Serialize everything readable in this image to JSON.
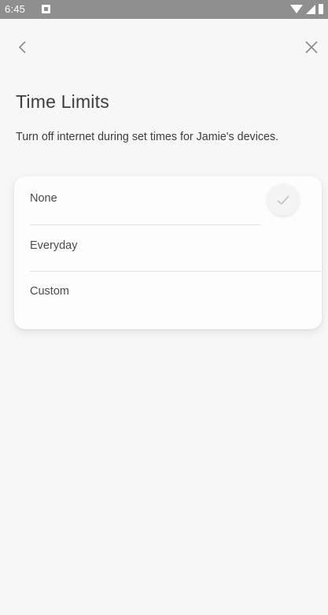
{
  "status_bar": {
    "time": "6:45",
    "icons": [
      "notification-icon",
      "wifi-icon",
      "signal-icon",
      "battery-icon"
    ]
  },
  "nav": {
    "back_icon": "chevron-left-icon",
    "close_icon": "close-icon"
  },
  "page": {
    "title": "Time Limits",
    "description": "Turn off internet during set times for Jamie's devices."
  },
  "options": {
    "items": [
      {
        "label": "None",
        "selected": true
      },
      {
        "label": "Everyday",
        "selected": false
      },
      {
        "label": "Custom",
        "selected": false
      }
    ]
  },
  "colors": {
    "background": "#f7f7f7",
    "status_bar": "#8f8f8f",
    "card": "#fdfdfd",
    "text": "#3d3d3d",
    "divider": "#e2e2e2"
  }
}
